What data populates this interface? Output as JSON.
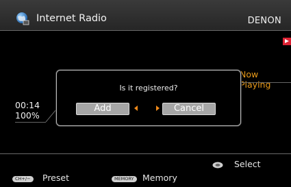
{
  "header": {
    "title": "Internet Radio",
    "brand": "DENON"
  },
  "main": {
    "now_playing": "Now Playing",
    "time": "00:14",
    "volume": "100%"
  },
  "dialog": {
    "question": "Is it registered?",
    "add_label": "Add",
    "cancel_label": "Cancel"
  },
  "footer": {
    "select_label": "Select",
    "preset_key": "CH+/−",
    "preset_label": "Preset",
    "memory_key": "MEMORY",
    "memory_label": "Memory"
  },
  "colors": {
    "accent": "#e89a1a",
    "play_tag": "#dd2233",
    "button": "#a6a6a6"
  },
  "icons": {
    "app": "globe-icon",
    "play": "play-icon",
    "select": "jog-dial-icon",
    "nav_left": "arrow-left-icon",
    "nav_right": "arrow-right-icon"
  }
}
